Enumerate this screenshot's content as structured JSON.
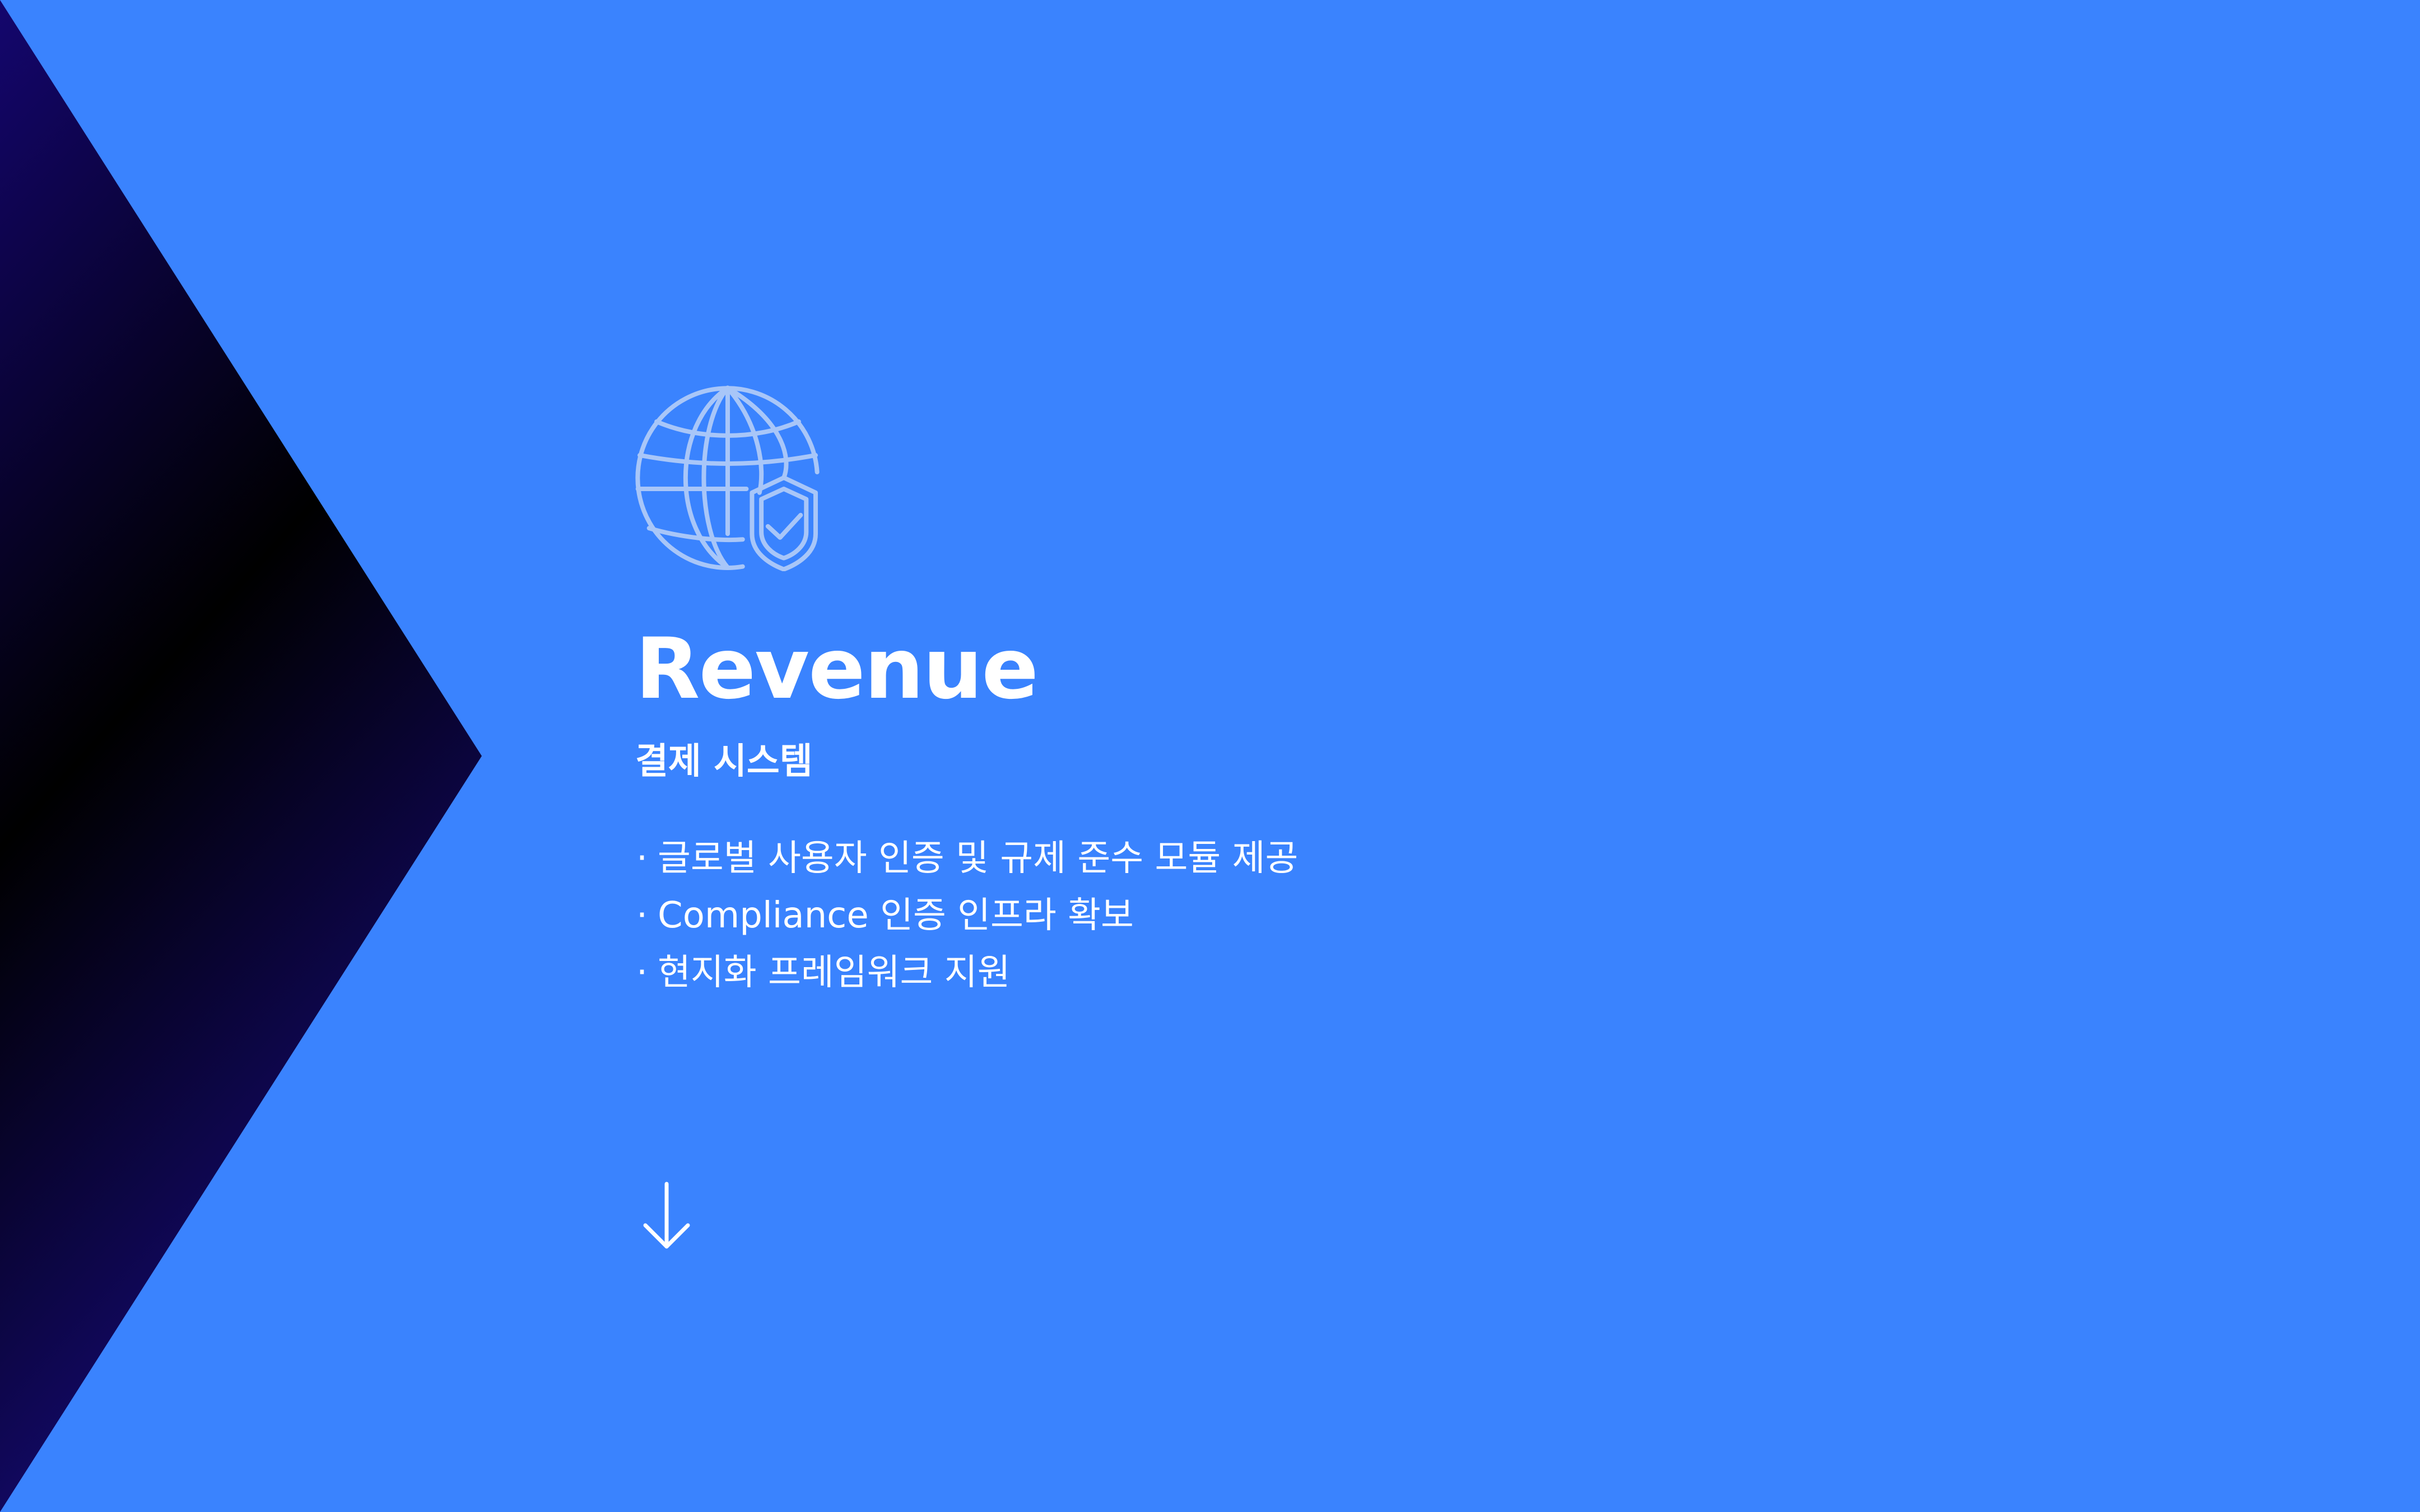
{
  "theme": {
    "background": "#3a83fe",
    "chevron_gradient": [
      "#14066e",
      "#000000",
      "#160a78"
    ],
    "icon_color": "#a8c6f8",
    "text_color": "#ffffff"
  },
  "hero": {
    "icon": "globe-shield-check-icon",
    "title": "Revenue",
    "subtitle": "결제 시스템",
    "bullet_glyph": "·",
    "features": [
      "글로벌 사용자 인증 및 규제 준수 모듈 제공",
      "Compliance 인증 인프라 확보",
      "현지화 프레임워크 지원"
    ]
  },
  "scroll_hint": {
    "icon": "arrow-down-icon"
  }
}
